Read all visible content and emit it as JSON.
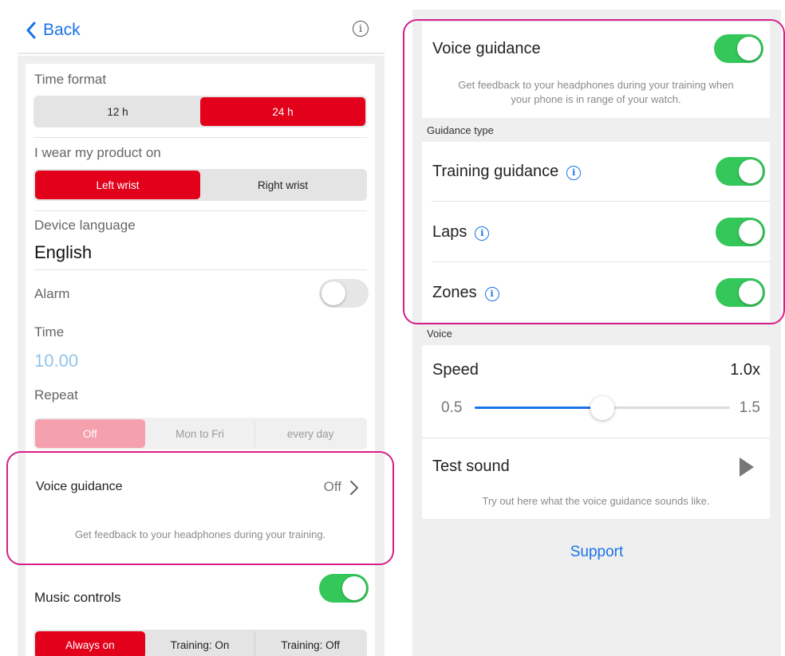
{
  "left": {
    "nav": {
      "back_label": "Back",
      "info_icon": "info-icon"
    },
    "time_format": {
      "label": "Time format",
      "options": [
        "12 h",
        "24 h"
      ],
      "selected": "24 h"
    },
    "wear": {
      "label": "I wear my product on",
      "options": [
        "Left wrist",
        "Right wrist"
      ],
      "selected": "Left wrist"
    },
    "device_language": {
      "label": "Device language",
      "value": "English"
    },
    "alarm": {
      "label": "Alarm",
      "enabled": false
    },
    "time": {
      "label": "Time",
      "value": "10.00"
    },
    "repeat": {
      "label": "Repeat",
      "options": [
        "Off",
        "Mon to Fri",
        "every day"
      ],
      "selected": "Off"
    },
    "voice_guidance": {
      "label": "Voice guidance",
      "value": "Off",
      "description": "Get feedback to your headphones during your training."
    },
    "music_controls": {
      "label": "Music controls",
      "enabled": true,
      "options": [
        "Always on",
        "Training: On",
        "Training: Off"
      ],
      "selected": "Always on"
    }
  },
  "right": {
    "voice_guidance": {
      "label": "Voice guidance",
      "enabled": true,
      "description_line1": "Get feedback to your headphones during your training when",
      "description_line2": "your phone is in range of your watch."
    },
    "guidance_type": {
      "section_label": "Guidance type",
      "items": [
        {
          "label": "Training guidance",
          "enabled": true
        },
        {
          "label": "Laps",
          "enabled": true
        },
        {
          "label": "Zones",
          "enabled": true
        }
      ]
    },
    "voice": {
      "section_label": "Voice",
      "speed_label": "Speed",
      "speed_value": "1.0x",
      "slider_min": "0.5",
      "slider_max": "1.5",
      "slider_level": 0.5
    },
    "test_sound": {
      "label": "Test sound",
      "description": "Try out here what the voice guidance sounds like."
    },
    "support_label": "Support"
  },
  "colors": {
    "accent_red": "#e2001a",
    "toggle_green": "#34c759",
    "link_blue": "#1a73e8",
    "highlight_magenta": "#d61f8a"
  }
}
